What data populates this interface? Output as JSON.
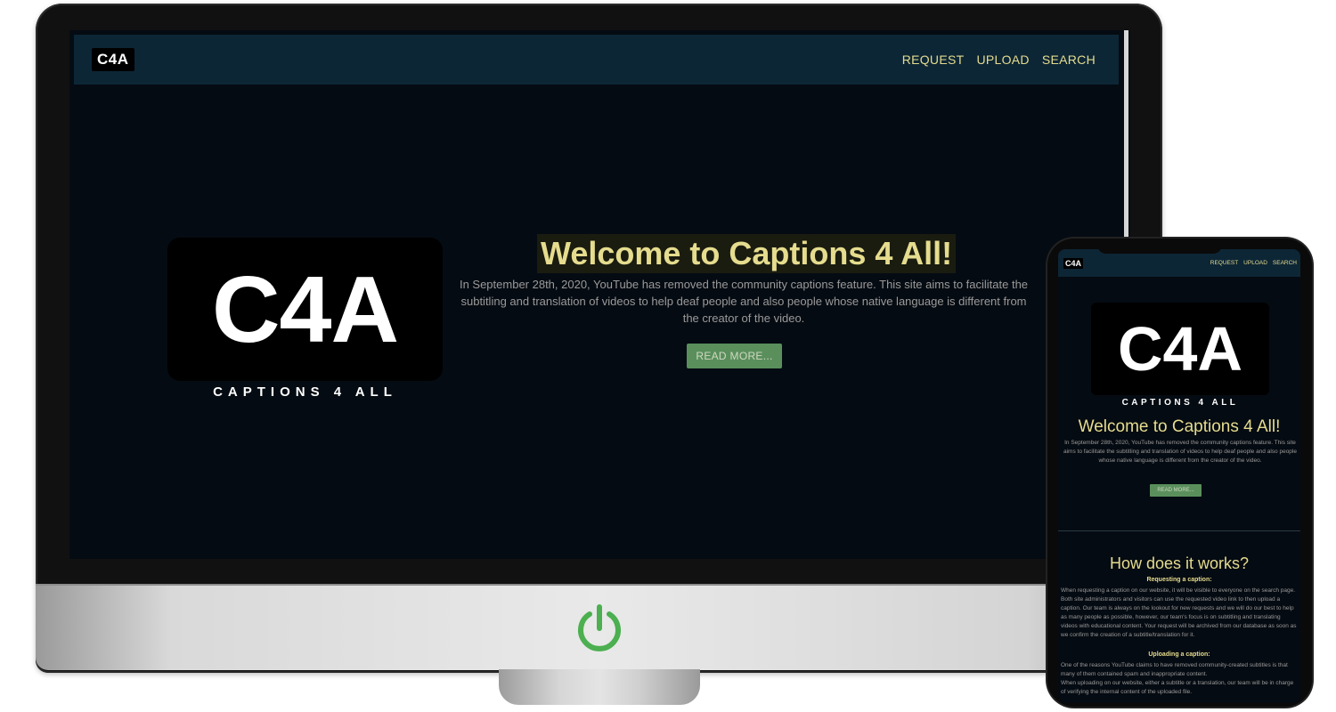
{
  "desktop": {
    "navbar": {
      "brand": "C4A",
      "links": [
        "REQUEST",
        "UPLOAD",
        "SEARCH"
      ]
    },
    "hero": {
      "logo_text": "C4A",
      "tagline": "CAPTIONS 4 ALL",
      "title": "Welcome to Captions 4 All!",
      "description": "In September 28th, 2020, YouTube has removed the community captions feature. This site aims to facilitate the subtitling and translation of videos to help deaf people and also people whose native language is different from the creator of the video.",
      "button": "READ MORE..."
    }
  },
  "mobile": {
    "navbar": {
      "brand": "C4A",
      "links": [
        "REQUEST",
        "UPLOAD",
        "SEARCH"
      ]
    },
    "hero": {
      "logo_text": "C4A",
      "tagline": "CAPTIONS 4 ALL",
      "title": "Welcome to Captions 4 All!",
      "description": "In September 28th, 2020, YouTube has removed the community captions feature. This site aims to facilitate the subtitling and translation of videos to help deaf people and also people whose native language is different from the creator of the video.",
      "button": "READ MORE..."
    },
    "how": {
      "title": "How does it works?",
      "requesting_title": "Requesting a caption:",
      "requesting_text": "When requesting a caption on our website, it will be visible to everyone on the search page. Both site administrators and visitors can use the requested video link to then upload a caption. Our team is always on the lookout for new requests and we will do our best to help as many people as possible, however, our team's focus is on subtitling and translating videos with educational content. Your request will be archived from our database as soon as we confirm the creation of a subtitle/translation for it.",
      "uploading_title": "Uploading a caption:",
      "uploading_text_1": "One of the reasons YouTube claims to have removed community-created subtitles is that many of them contained spam and inappropriate content.",
      "uploading_text_2": "When uploading on our website, either a subtitle or a translation, our team will be in charge of verifying the internal content of the uploaded file."
    }
  },
  "colors": {
    "background": "#050b12",
    "navbar": "#0d2636",
    "accent": "#e5dc8e",
    "button": "#5a8f5c",
    "power_icon": "#4caf50"
  },
  "icons": {
    "power": "power-icon"
  }
}
